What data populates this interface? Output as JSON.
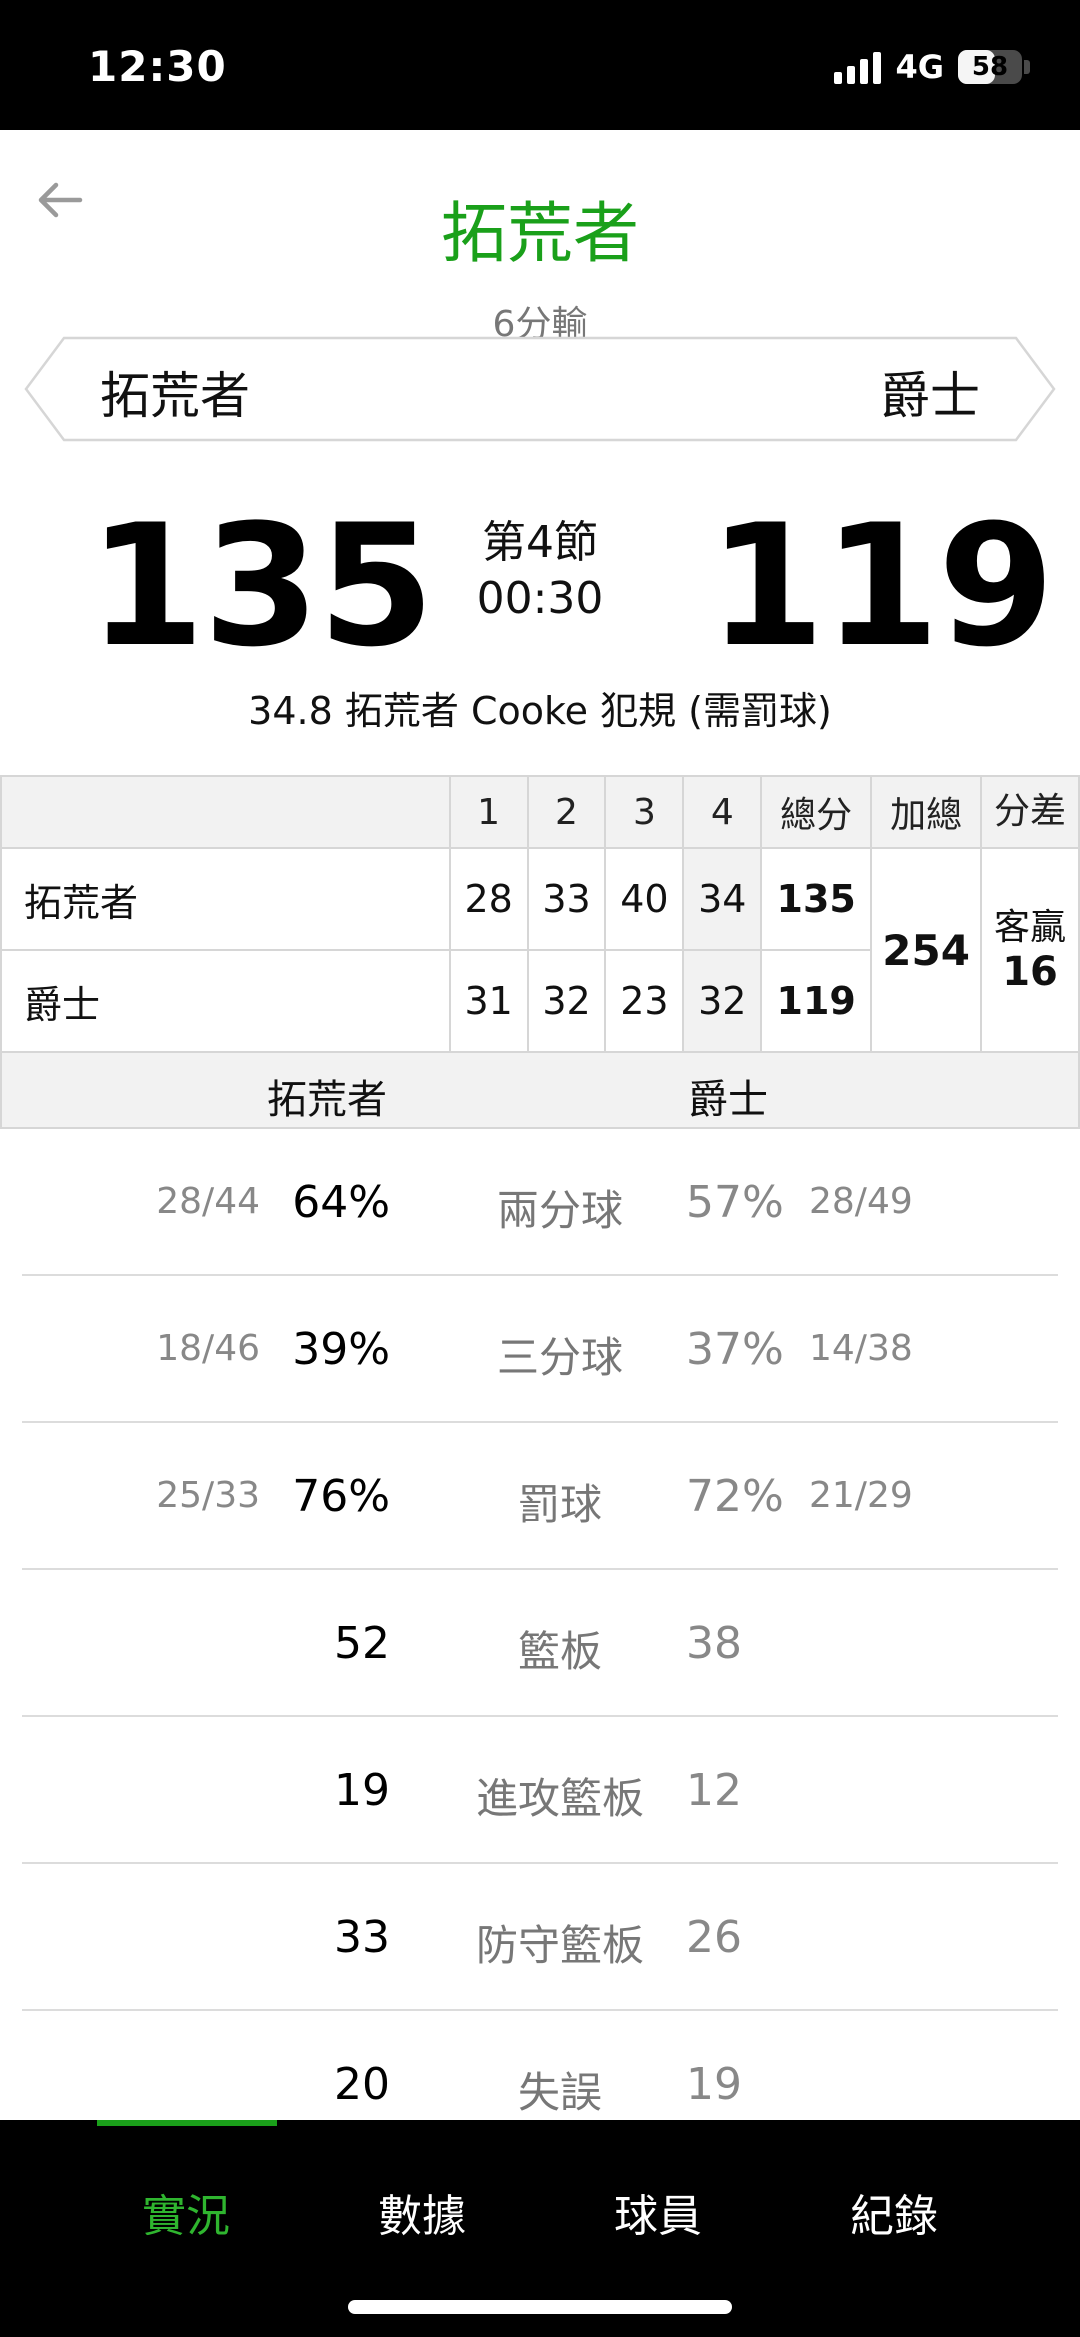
{
  "status_bar": {
    "time": "12:30",
    "network": "4G",
    "battery": "58",
    "battery_level_percent": 58
  },
  "header": {
    "title": "拓荒者",
    "subtitle": "6分輸",
    "back_icon": "arrow-left-icon"
  },
  "matchup": {
    "left_team": "拓荒者",
    "right_team": "爵士"
  },
  "scoreboard": {
    "home_score": "135",
    "away_score": "119",
    "period": "第4節",
    "clock": "00:30"
  },
  "last_play": "34.8 拓荒者 Cooke 犯規 (需罰球)",
  "box_score": {
    "headers": [
      "1",
      "2",
      "3",
      "4",
      "總分",
      "加總",
      "分差"
    ],
    "rows": [
      {
        "team": "拓荒者",
        "q": [
          "28",
          "33",
          "40",
          "34"
        ],
        "total": "135"
      },
      {
        "team": "爵士",
        "q": [
          "31",
          "32",
          "23",
          "32"
        ],
        "total": "119"
      }
    ],
    "combined": "254",
    "diff_label": "客贏",
    "diff_value": "16"
  },
  "compare_header": {
    "left": "拓荒者",
    "right": "爵士"
  },
  "stats": [
    {
      "label": "兩分球",
      "left_frac": "28/44",
      "left": "64%",
      "right": "57%",
      "right_frac": "28/49"
    },
    {
      "label": "三分球",
      "left_frac": "18/46",
      "left": "39%",
      "right": "37%",
      "right_frac": "14/38"
    },
    {
      "label": "罰球",
      "left_frac": "25/33",
      "left": "76%",
      "right": "72%",
      "right_frac": "21/29"
    },
    {
      "label": "籃板",
      "left_frac": "",
      "left": "52",
      "right": "38",
      "right_frac": ""
    },
    {
      "label": "進攻籃板",
      "left_frac": "",
      "left": "19",
      "right": "12",
      "right_frac": ""
    },
    {
      "label": "防守籃板",
      "left_frac": "",
      "left": "33",
      "right": "26",
      "right_frac": ""
    },
    {
      "label": "失誤",
      "left_frac": "",
      "left": "20",
      "right": "19",
      "right_frac": ""
    }
  ],
  "bottom_nav": {
    "items": [
      "實況",
      "數據",
      "球員",
      "紀錄"
    ],
    "active_index": 0
  },
  "colors": {
    "accent": "#1aa01a",
    "header_bg": "#f2f2f2",
    "muted_text": "#888888"
  }
}
